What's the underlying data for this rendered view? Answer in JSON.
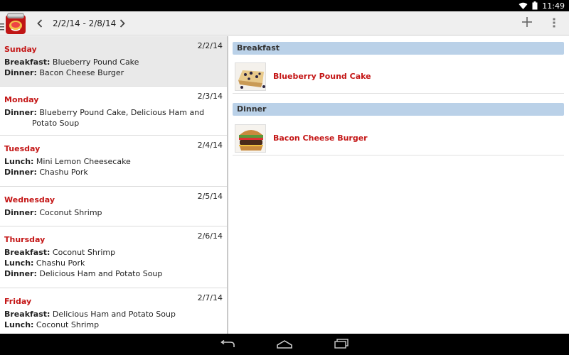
{
  "status_bar": {
    "time": "11:49"
  },
  "action_bar": {
    "date_range": "2/2/14 - 2/8/14"
  },
  "days": [
    {
      "name": "Sunday",
      "date": "2/2/14",
      "selected": true,
      "meals": [
        {
          "type": "Breakfast:",
          "items": "Blueberry Pound Cake"
        },
        {
          "type": "Dinner:",
          "items": "Bacon Cheese Burger"
        }
      ]
    },
    {
      "name": "Monday",
      "date": "2/3/14",
      "selected": false,
      "meals": [
        {
          "type": "Dinner:",
          "items": "Blueberry Pound Cake, Delicious Ham and Potato Soup"
        }
      ]
    },
    {
      "name": "Tuesday",
      "date": "2/4/14",
      "selected": false,
      "meals": [
        {
          "type": "Lunch:",
          "items": "Mini Lemon Cheesecake"
        },
        {
          "type": "Dinner:",
          "items": "Chashu Pork"
        }
      ]
    },
    {
      "name": "Wednesday",
      "date": "2/5/14",
      "selected": false,
      "meals": [
        {
          "type": "Dinner:",
          "items": "Coconut Shrimp"
        }
      ]
    },
    {
      "name": "Thursday",
      "date": "2/6/14",
      "selected": false,
      "meals": [
        {
          "type": "Breakfast:",
          "items": "Coconut Shrimp"
        },
        {
          "type": "Lunch:",
          "items": "Chashu Pork"
        },
        {
          "type": "Dinner:",
          "items": "Delicious Ham and Potato Soup"
        }
      ]
    },
    {
      "name": "Friday",
      "date": "2/7/14",
      "selected": false,
      "meals": [
        {
          "type": "Breakfast:",
          "items": "Delicious Ham and Potato Soup"
        },
        {
          "type": "Lunch:",
          "items": "Coconut Shrimp"
        }
      ]
    }
  ],
  "detail": {
    "sections": [
      {
        "title": "Breakfast",
        "recipes": [
          {
            "name": "Blueberry Pound Cake",
            "thumb": "blueberry-pound-cake-photo"
          }
        ]
      },
      {
        "title": "Dinner",
        "recipes": [
          {
            "name": "Bacon Cheese Burger",
            "thumb": "bacon-cheese-burger-photo"
          }
        ]
      }
    ]
  },
  "colors": {
    "accent_red": "#c41616",
    "section_blue": "#bad1e8",
    "action_bar": "#efefef",
    "selected_row": "#e9e9e9"
  }
}
